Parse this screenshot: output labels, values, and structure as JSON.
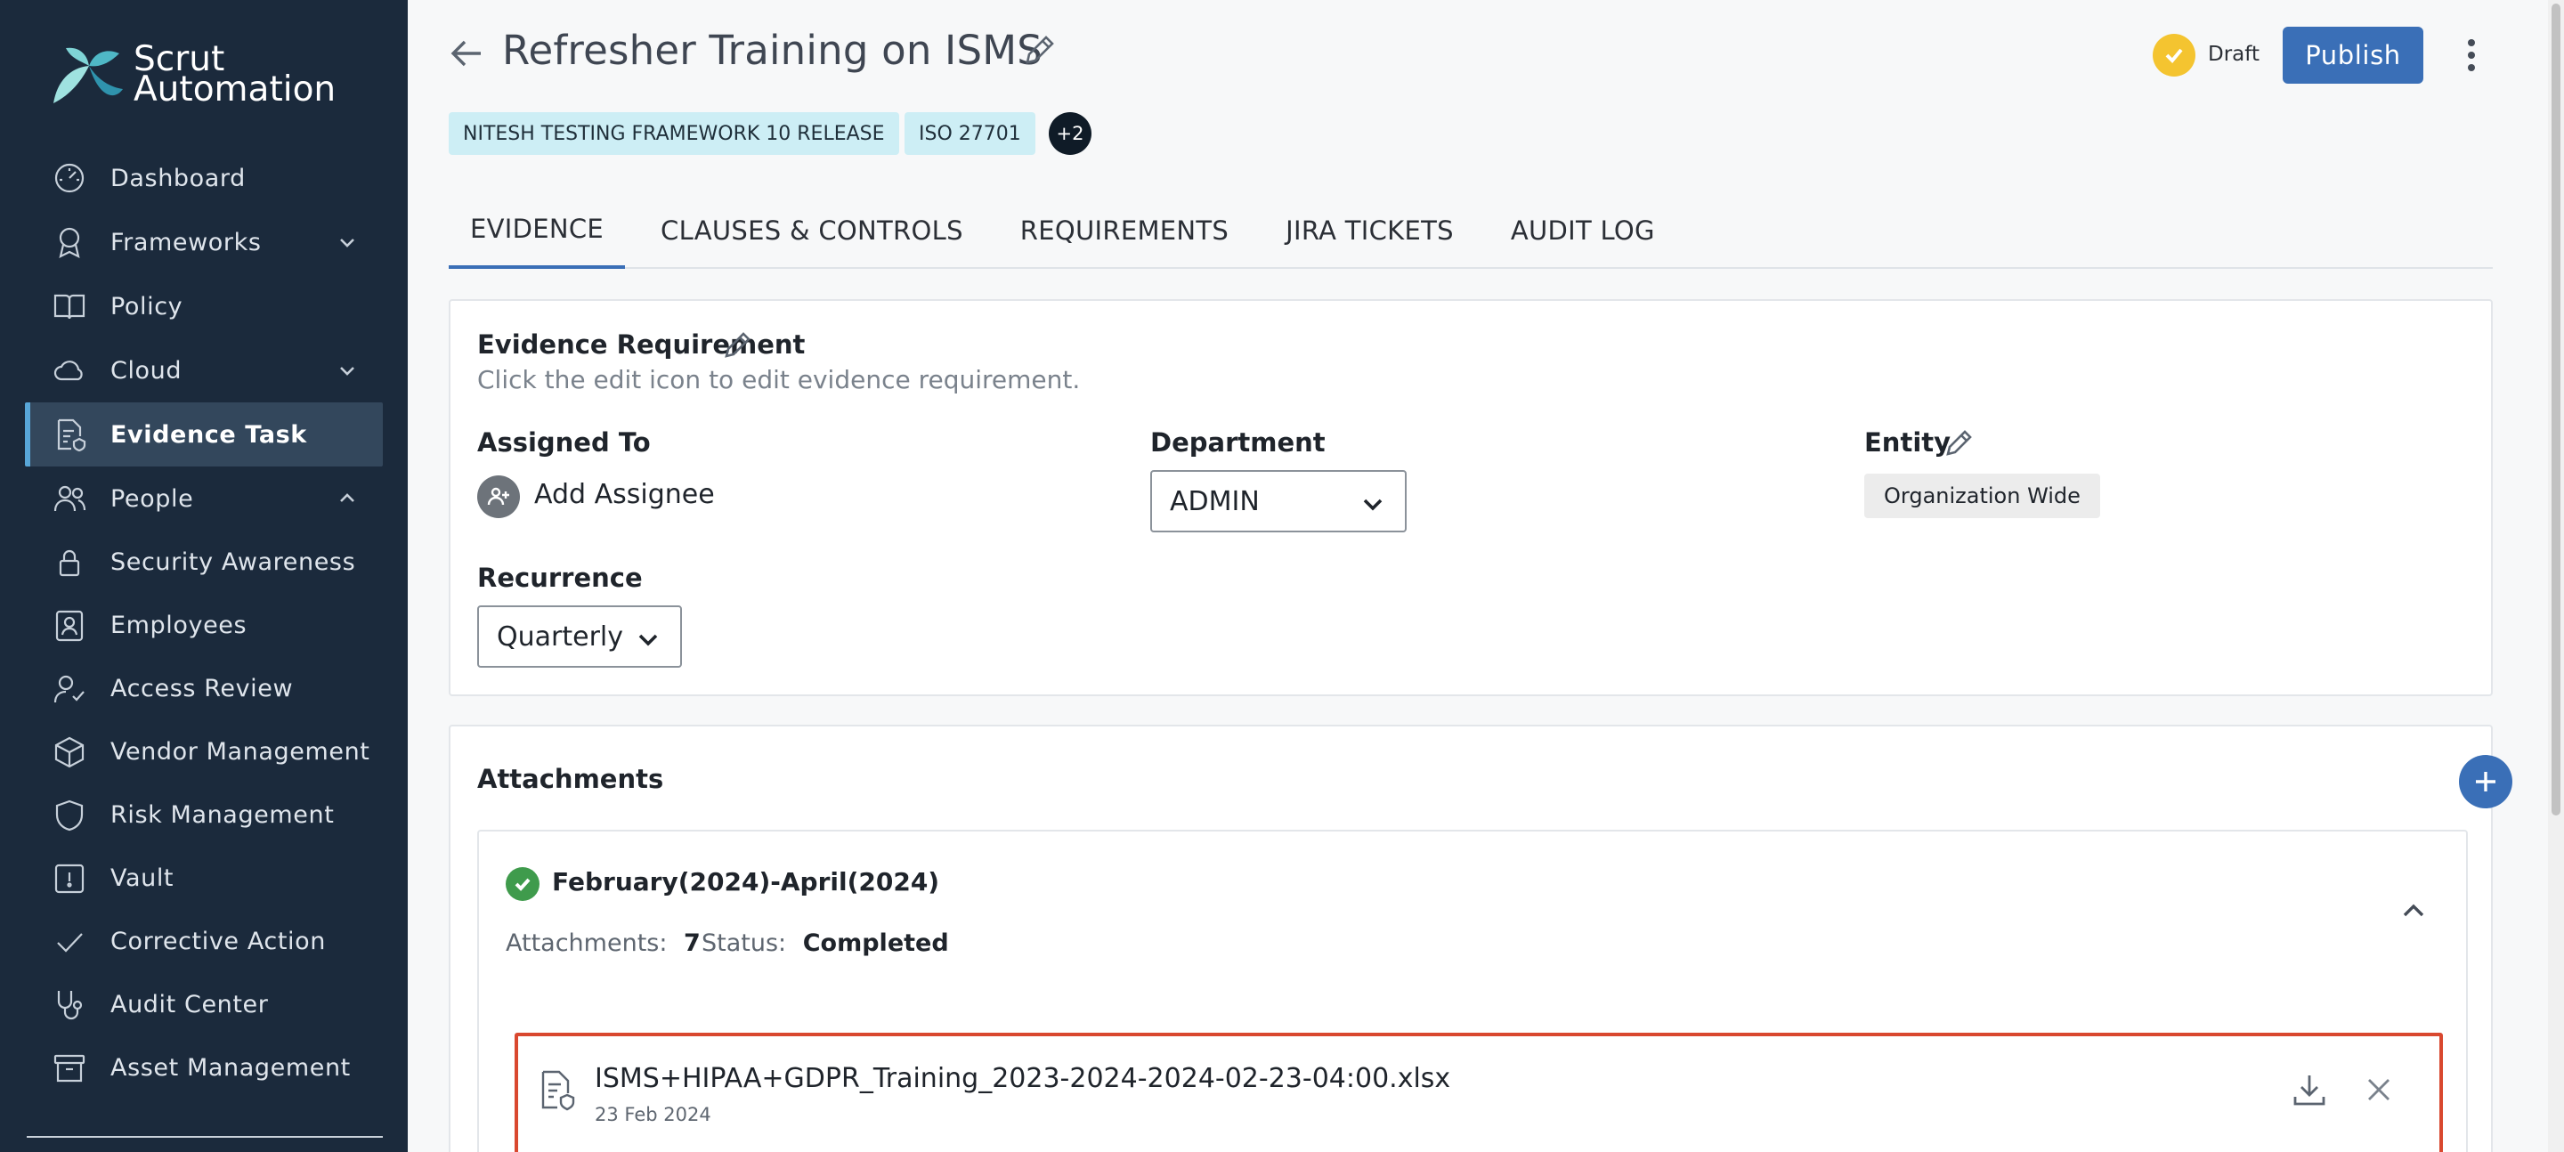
{
  "brand": {
    "line1": "Scrut",
    "line2": "Automation"
  },
  "sidebar": {
    "items": [
      {
        "label": "Dashboard",
        "icon": "dashboard-icon"
      },
      {
        "label": "Frameworks",
        "icon": "award-icon",
        "chevron": "down"
      },
      {
        "label": "Policy",
        "icon": "book-icon"
      },
      {
        "label": "Cloud",
        "icon": "cloud-icon",
        "chevron": "down"
      },
      {
        "label": "Evidence Task",
        "icon": "evidence-file-icon",
        "active": true
      },
      {
        "label": "People",
        "icon": "people-icon",
        "chevron": "up"
      },
      {
        "label": "Security Awareness",
        "icon": "lock-icon"
      },
      {
        "label": "Employees",
        "icon": "id-badge-icon"
      },
      {
        "label": "Access Review",
        "icon": "user-check-icon"
      },
      {
        "label": "Vendor Management",
        "icon": "box-icon"
      },
      {
        "label": "Risk Management",
        "icon": "shield-icon"
      },
      {
        "label": "Vault",
        "icon": "vault-icon"
      },
      {
        "label": "Corrective Action",
        "icon": "check-icon"
      },
      {
        "label": "Audit Center",
        "icon": "stethoscope-icon"
      },
      {
        "label": "Asset Management",
        "icon": "archive-icon"
      }
    ]
  },
  "header": {
    "title": "Refresher Training on ISMS",
    "status": "Draft",
    "publish_label": "Publish",
    "tags": [
      "NITESH TESTING FRAMEWORK 10 RELEASE",
      "ISO 27701"
    ],
    "more_tags": "+2"
  },
  "tabs": [
    {
      "label": "EVIDENCE",
      "active": true
    },
    {
      "label": "CLAUSES & CONTROLS"
    },
    {
      "label": "REQUIREMENTS"
    },
    {
      "label": "JIRA TICKETS"
    },
    {
      "label": "AUDIT LOG"
    }
  ],
  "evidence": {
    "requirement_label": "Evidence Requirement",
    "requirement_hint": "Click the edit icon to edit evidence requirement.",
    "assigned_to_label": "Assigned To",
    "add_assignee": "Add Assignee",
    "department_label": "Department",
    "department_value": "ADMIN",
    "entity_label": "Entity",
    "entity_value": "Organization Wide",
    "recurrence_label": "Recurrence",
    "recurrence_value": "Quarterly"
  },
  "attachments": {
    "title": "Attachments",
    "period": {
      "title": "February(2024)-April(2024)",
      "count_label": "Attachments:",
      "count": "7",
      "status_label": "Status:",
      "status": "Completed"
    },
    "files": [
      {
        "name": "ISMS+HIPAA+GDPR_Training_2023-2024-2024-02-23-04:00.xlsx",
        "date": "23 Feb 2024"
      }
    ]
  },
  "colors": {
    "sidebar_bg": "#1b2a3c",
    "accent": "#3a6fb7",
    "draft": "#f4c430",
    "completed": "#3f9b4c",
    "highlight": "#d9482f"
  }
}
